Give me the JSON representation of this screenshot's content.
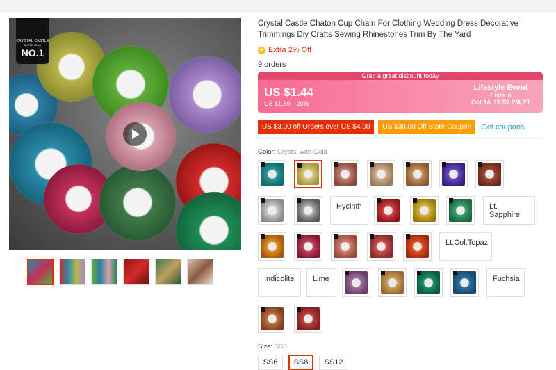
{
  "product": {
    "title": "Crystal Castle Chaton Cup Chain For Clothing Wedding Dress Decorative Trimmings Diy Crafts Sewing Rhinestones Trim By The Yard",
    "extra_off": "Extra 2% Off",
    "orders": "9 orders"
  },
  "badge": {
    "brand": "CRYSTAL CASTLE",
    "tagline": "SUPER ONLY",
    "rank": "NO.1"
  },
  "promo": {
    "strip": "Grab a great discount today",
    "price": "US $1.44",
    "old_price": "US $1.80",
    "discount": "-20%",
    "event_name": "Lifestyle Event",
    "ends_label": "Ends in",
    "ends_date": "Oct 14, 11:59 PM PT"
  },
  "coupons": {
    "c1": "US $3.00 off Orders over US $4.00",
    "c2": "US $30.00 Off Store Coupon",
    "get": "Get coupons"
  },
  "color": {
    "label": "Color:",
    "selected": "Crystal with Gold",
    "text_options": {
      "hycinth": "Hycinth",
      "lt_sapphire": "Lt. Sapphire",
      "lt_col_topaz": "Lt.Col.Topaz",
      "indicolite": "Indicolite",
      "lime": "Lime",
      "fuchsia": "Fuchsia"
    }
  },
  "size": {
    "label": "Size:",
    "selected": "SS8",
    "options": [
      "SS6",
      "SS8",
      "SS12"
    ]
  },
  "colors": {
    "accent": "#e62e04",
    "promo": "#f86a92",
    "link": "#2e9cc3"
  }
}
